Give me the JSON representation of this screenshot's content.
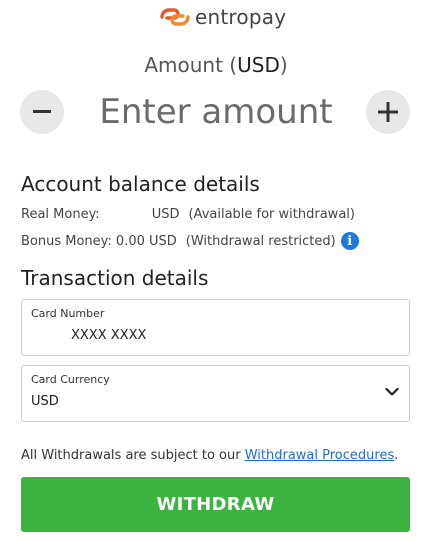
{
  "brand": {
    "name": "entropay",
    "logo_colors": [
      "#e8562a",
      "#f28a30"
    ]
  },
  "amount": {
    "label": "Amount (",
    "currency": "USD",
    "label_close": ")",
    "placeholder": "Enter amount",
    "decrement_icon": "minus-icon",
    "increment_icon": "plus-icon"
  },
  "account_balance": {
    "title": "Account balance details",
    "real_money_label": "Real Money:",
    "real_money_currency": "USD",
    "real_money_note": "(Available for withdrawal)",
    "bonus_money_label": "Bonus Money: 0.00 USD",
    "bonus_money_note": "(Withdrawal restricted)",
    "info_icon": "info-icon",
    "info_glyph": "i"
  },
  "transaction": {
    "title": "Transaction details",
    "card_number_label": "Card Number",
    "card_number_value": "XXXX XXXX",
    "card_currency_label": "Card Currency",
    "card_currency_value": "USD"
  },
  "footer": {
    "note_text": "All Withdrawals are subject to our ",
    "link_text": "Withdrawal Procedures",
    "note_end": "."
  },
  "withdraw_button": {
    "label": "WITHDRAW",
    "color": "#3db340"
  }
}
